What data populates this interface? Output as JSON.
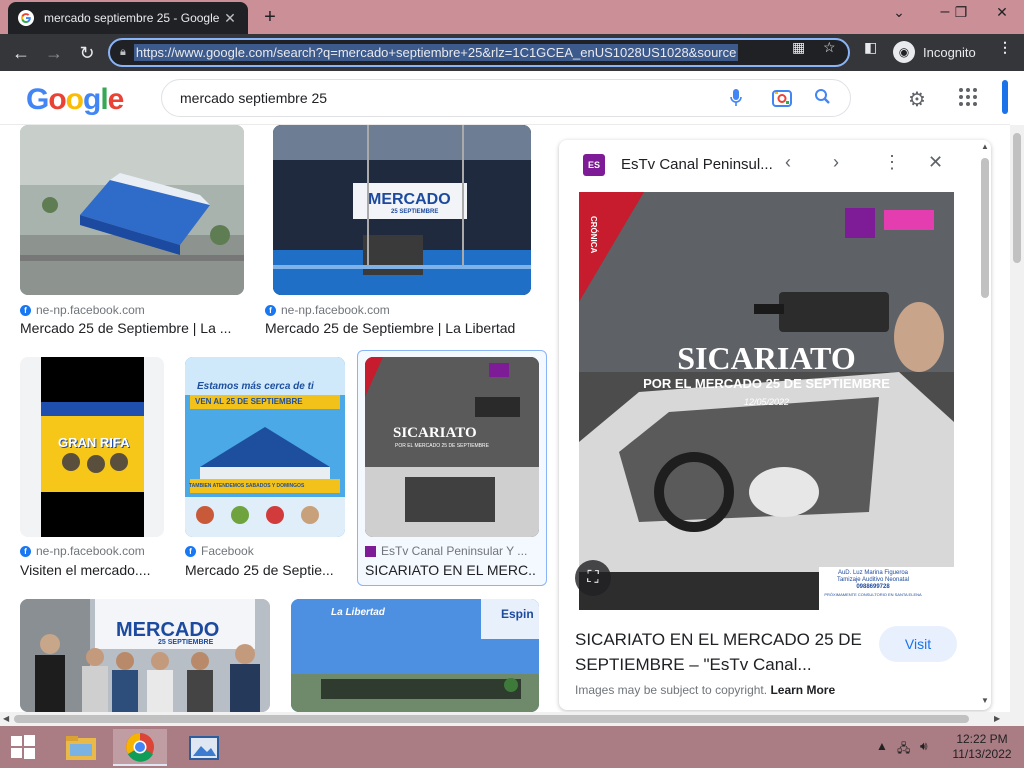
{
  "browser": {
    "tab_title": "mercado septiembre 25 - Google",
    "tab_close": "✕",
    "new_tab": "+",
    "url": "https://www.google.com/search?q=mercado+septiembre+25&rlz=1C1GCEA_enUS1028US1028&source",
    "incognito_label": "Incognito"
  },
  "google": {
    "logo": "Google",
    "query": "mercado septiembre 25"
  },
  "results": [
    {
      "source": "ne-np.facebook.com",
      "title": "Mercado 25 de Septiembre | La ..."
    },
    {
      "source": "ne-np.facebook.com",
      "title": "Mercado 25 de Septiembre | La Libertad"
    },
    {
      "source": "ne-np.facebook.com",
      "title": "Visiten el mercado...."
    },
    {
      "source": "Facebook",
      "title": "Mercado 25 de Septie..."
    },
    {
      "source": "EsTv Canal Peninsular Y ...",
      "title": "SICARIATO EN EL MERC..."
    }
  ],
  "image_text": {
    "mercado_sign": "MERCADO",
    "mercado_sign_sub": "25 SEPTIEMBRE",
    "gran_rifa": "GRAN RIFA",
    "estamos": "Estamos más cerca de ti",
    "ven_al": "VEN AL 25 DE SEPTIEMBRE",
    "atendemos": "TAMBIÉN ATENDEMOS SÁBADOS Y DOMINGOS",
    "sicariato": "SICARIATO",
    "por_el": "POR EL MERCADO 25 DE SEPTIEMBRE",
    "fecha": "12/05/2022",
    "la_libertad": "La Libertad",
    "espin": "Espin"
  },
  "panel": {
    "source_name": "EsTv Canal Peninsul...",
    "headline": "SICARIATO",
    "subheadline": "POR EL MERCADO 25 DE SEPTIEMBRE",
    "date": "12/05/2022",
    "side_label": "CRÓNICA",
    "doctor_name": "AuD. Luz Marina Figueroa",
    "doctor_sub": "Tamizaje Auditivo Neonatal",
    "doctor_phone": "0988699728",
    "doctor_note": "PRÓXIMAMENTE CONSULTORIO EN SANTA ELENA",
    "title": "SICARIATO EN EL MERCADO 25 DE SEPTIEMBRE – \"EsTv Canal...",
    "visit": "Visit",
    "copyright": "Images may be subject to copyright.",
    "learn_more": "Learn More"
  },
  "taskbar": {
    "time": "12:22 PM",
    "date": "11/13/2022"
  }
}
